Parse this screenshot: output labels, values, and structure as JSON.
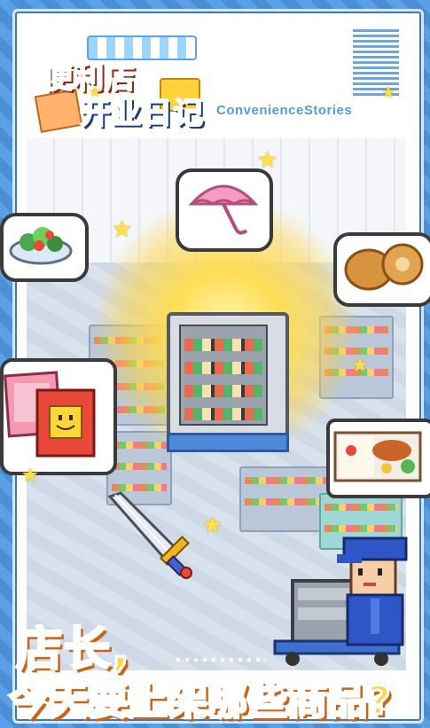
{
  "logo": {
    "line1": "便利店",
    "line2": "开业日记",
    "subtitle": "ConvenienceStories"
  },
  "headline": {
    "line1": "店长,",
    "line2": "今天要上架哪些商品?"
  },
  "items": {
    "salad": "salad-icon",
    "umbrella": "umbrella-icon",
    "bread": "bread-icon",
    "cards": "cards-icon",
    "bento": "bento-icon",
    "sword": "sword-icon",
    "showcase": "display-cooler-icon"
  },
  "colors": {
    "background_blue": "#4a8fd6",
    "title_red": "#e8492c",
    "title_blue": "#2f6fd0",
    "headline_yellow": "#ffd84a",
    "headline_outline": "#c9641b",
    "star_yellow": "#ffe04a"
  }
}
